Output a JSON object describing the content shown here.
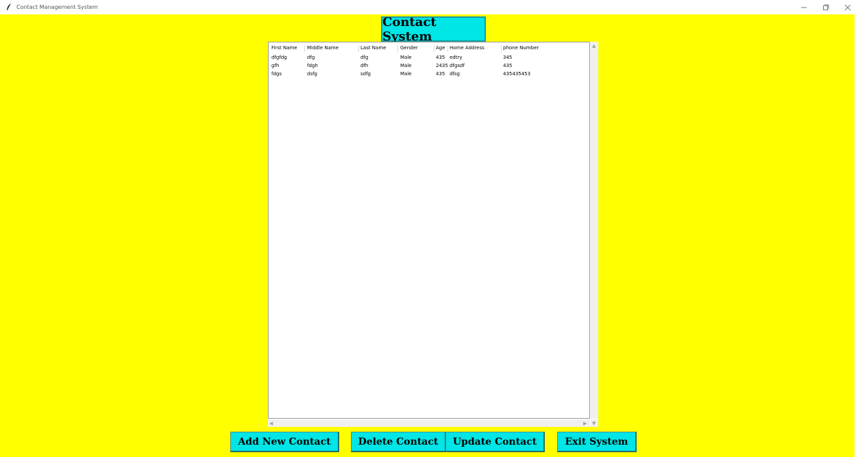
{
  "window": {
    "title": "Contact Management System",
    "icon": "feather-icon",
    "minimize_icon": "minimize-icon",
    "restore_icon": "restore-icon",
    "close_icon": "close-icon"
  },
  "heading": "Contact System",
  "table": {
    "columns": [
      "First Name",
      "Middle Name",
      "Last Name",
      "Gender",
      "Age",
      "Home Address",
      "phone Number"
    ],
    "rows": [
      [
        "dfgfdg",
        "dfg",
        "dfg",
        "Male",
        "435",
        "edtry",
        "345"
      ],
      [
        "gfh",
        "fdgh",
        "dfh",
        "Male",
        "2435",
        "dfgsdf",
        "435"
      ],
      [
        "fdgs",
        "dsfg",
        "sdfg",
        "Male",
        "435",
        "dfsg",
        "435435453"
      ]
    ]
  },
  "buttons": {
    "add": "Add New Contact",
    "delete": "Delete Contact",
    "update": "Update Contact",
    "exit": "Exit System"
  },
  "colors": {
    "background": "#ffff00",
    "accent": "#00e5e5"
  }
}
